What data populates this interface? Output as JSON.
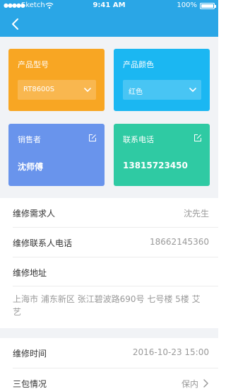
{
  "status_bar": {
    "signal": "●●●●●",
    "carrier": "Sketch",
    "time": "9:41 AM",
    "battery": "100%"
  },
  "cards": {
    "model": {
      "label": "产品型号",
      "value": "RT8600S"
    },
    "color": {
      "label": "产品颜色",
      "value": "红色"
    },
    "seller": {
      "label": "销售者",
      "value": "沈师傅"
    },
    "phone": {
      "label": "联系电话",
      "value": "13815723450"
    }
  },
  "details": {
    "requester": {
      "label": "维修需求人",
      "value": "沈先生"
    },
    "contact_phone": {
      "label": "维修联系人电话",
      "value": "18662145360"
    },
    "address": {
      "label": "维修地址",
      "value": "上海市 浦东新区 张江碧波路690号 七号楼 5楼 艾艺"
    },
    "repair_time": {
      "label": "维修时间",
      "value": "2016-10-23 15:00"
    },
    "warranty": {
      "label": "三包情况",
      "value": "保内"
    }
  },
  "colors": {
    "header": "#2aa6e6",
    "model_card": "#f8a623",
    "color_card": "#1bb7f2",
    "seller_card": "#6994ec",
    "phone_card": "#2fcaa3"
  },
  "icons": {
    "back": "back-chevron-icon",
    "edit": "edit-icon",
    "dropdown": "chevron-down-icon",
    "row_arrow": "chevron-right-icon"
  }
}
